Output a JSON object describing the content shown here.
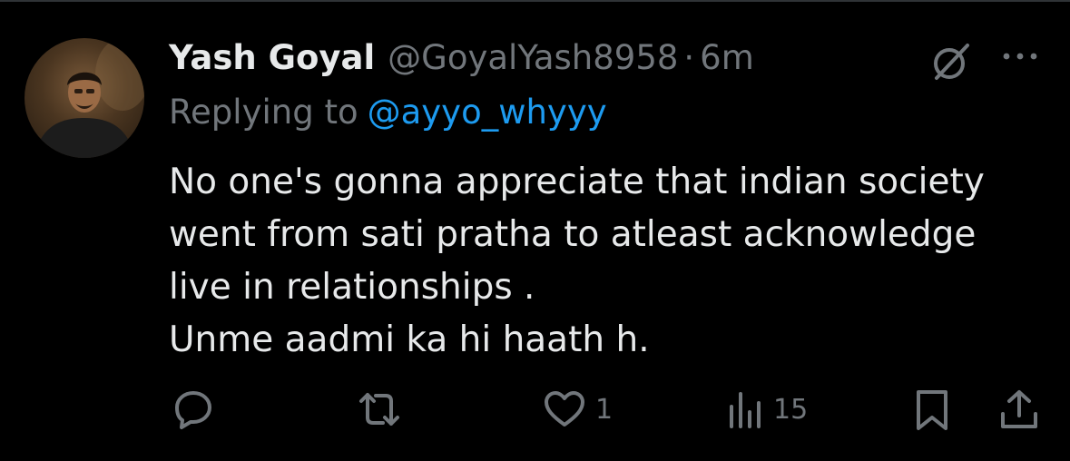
{
  "tweet": {
    "author_name": "Yash Goyal",
    "handle": "@GoyalYash8958",
    "separator": "·",
    "time": "6m",
    "reply_prefix": "Replying to",
    "reply_mention": "@ayyo_whyyy",
    "lines": [
      "No one's gonna appreciate that indian society",
      "went from sati pratha to atleast acknowledge",
      "live in relationships .",
      "Unme aadmi ka hi haath h."
    ]
  },
  "actions": {
    "reply": {
      "icon": "reply-icon",
      "count": ""
    },
    "retweet": {
      "icon": "retweet-icon",
      "count": ""
    },
    "like": {
      "icon": "heart-icon",
      "count": "1"
    },
    "views": {
      "icon": "views-icon",
      "count": "15"
    },
    "bookmark": {
      "icon": "bookmark-icon"
    },
    "share": {
      "icon": "share-icon"
    }
  },
  "colors": {
    "background": "#000000",
    "text": "#e7e9ea",
    "muted": "#71767b",
    "link": "#1d9bf0"
  }
}
